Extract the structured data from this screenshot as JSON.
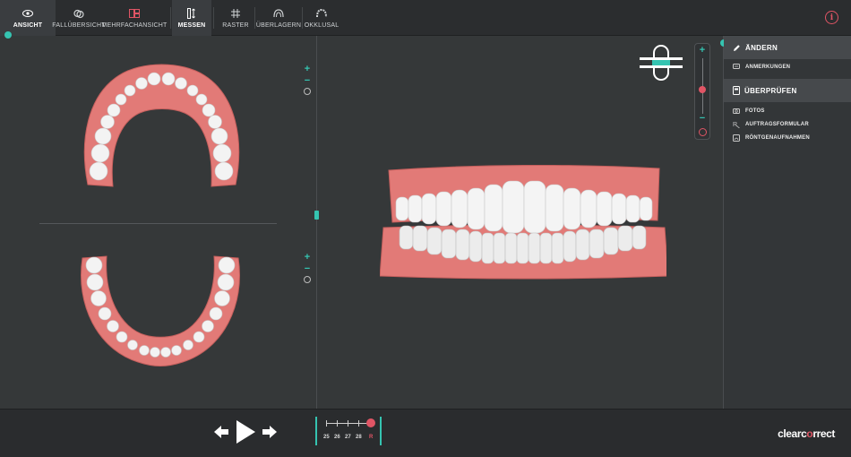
{
  "toolbar": {
    "items": [
      {
        "label": "ANSICHT",
        "icon": "eye-icon"
      },
      {
        "label": "FALLÜBERSICHT",
        "icon": "case-overview-icon"
      },
      {
        "label": "MEHRFACHANSICHT",
        "icon": "multi-view-icon"
      },
      {
        "label": "MESSEN",
        "icon": "measure-icon"
      },
      {
        "label": "RASTER",
        "icon": "grid-icon"
      },
      {
        "label": "ÜBERLAGERN",
        "icon": "overlay-icon"
      },
      {
        "label": "OKKLUSAL",
        "icon": "occlusal-icon"
      }
    ],
    "info_label": "i"
  },
  "zoom": {
    "plus": "+",
    "minus": "−"
  },
  "right_panel": {
    "edit_header": "ÄNDERN",
    "edit_items": [
      "ANMERKUNGEN"
    ],
    "review_header": "ÜBERPRÜFEN",
    "review_items": [
      "FOTOS",
      "AUFTRAGSFORMULAR",
      "RÖNTGENAUFNAHMEN"
    ]
  },
  "timeline": {
    "stages": [
      "25",
      "26",
      "27",
      "28",
      "R"
    ],
    "current": "R"
  },
  "brand": {
    "part1": "clearc",
    "part2": "o",
    "part3": "rrect"
  },
  "colors": {
    "accent_teal": "#35c4b1",
    "accent_red": "#e05565",
    "gum": "#e07a78",
    "tooth": "#f2f2f2"
  }
}
